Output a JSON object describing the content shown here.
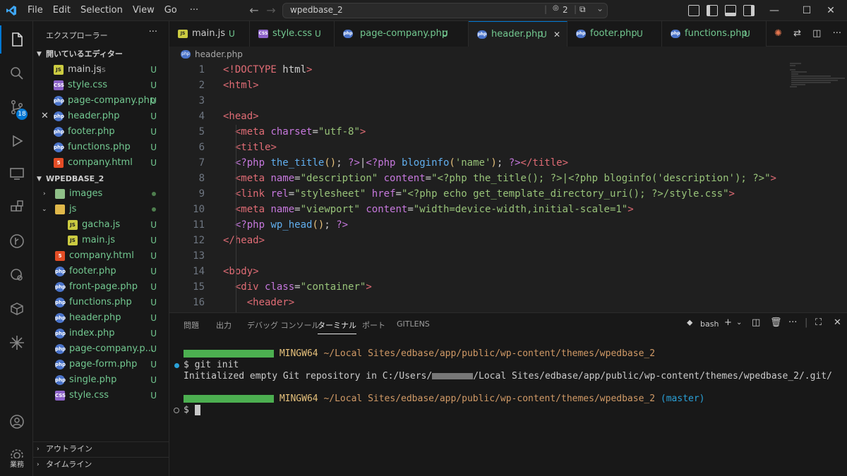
{
  "titlebar": {
    "menu": [
      "File",
      "Edit",
      "Selection",
      "View",
      "Go",
      "···"
    ],
    "search": "wpedbase_2",
    "source_control_count": "2"
  },
  "activity": {
    "scm_badge": "18",
    "account_label": "業務"
  },
  "sidebar": {
    "title": "エクスプローラー",
    "open_editors_title": "開いているエディター",
    "open_editors": [
      {
        "name": "main.js",
        "extra": "js",
        "icon": "js",
        "status": "U"
      },
      {
        "name": "style.css",
        "icon": "css",
        "status": "U"
      },
      {
        "name": "page-company.php",
        "icon": "php",
        "status": "U"
      },
      {
        "name": "header.php",
        "icon": "php",
        "status": "U"
      },
      {
        "name": "footer.php",
        "icon": "php",
        "status": "U"
      },
      {
        "name": "functions.php",
        "icon": "php",
        "status": "U"
      },
      {
        "name": "company.html",
        "icon": "html",
        "status": "U"
      }
    ],
    "project_title": "WPEDBASE_2",
    "tree": [
      {
        "name": "images",
        "icon": "folder",
        "status": "dot"
      },
      {
        "name": "js",
        "icon": "jsfolder",
        "status": "dot"
      },
      {
        "name": "gacha.js",
        "icon": "js",
        "status": "U"
      },
      {
        "name": "main.js",
        "icon": "js",
        "status": "U"
      },
      {
        "name": "company.html",
        "icon": "html",
        "status": "U"
      },
      {
        "name": "footer.php",
        "icon": "php",
        "status": "U"
      },
      {
        "name": "front-page.php",
        "icon": "php",
        "status": "U"
      },
      {
        "name": "functions.php",
        "icon": "php",
        "status": "U"
      },
      {
        "name": "header.php",
        "icon": "php",
        "status": "U"
      },
      {
        "name": "index.php",
        "icon": "php",
        "status": "U"
      },
      {
        "name": "page-company.p...",
        "icon": "php",
        "status": "U"
      },
      {
        "name": "page-form.php",
        "icon": "php",
        "status": "U"
      },
      {
        "name": "single.php",
        "icon": "php",
        "status": "U"
      },
      {
        "name": "style.css",
        "icon": "css",
        "status": "U"
      }
    ],
    "outline": "アウトライン",
    "timeline": "タイムライン"
  },
  "tabs": [
    {
      "name": "main.js",
      "icon": "js",
      "status": "U"
    },
    {
      "name": "style.css",
      "icon": "css",
      "status": "U"
    },
    {
      "name": "page-company.php",
      "icon": "php",
      "status": "U"
    },
    {
      "name": "header.php",
      "icon": "php",
      "status": "U"
    },
    {
      "name": "footer.php",
      "icon": "php",
      "status": "U"
    },
    {
      "name": "functions.php",
      "icon": "php",
      "status": "U"
    }
  ],
  "breadcrumb": "header.php",
  "editor": {
    "line_numbers": [
      "1",
      "2",
      "3",
      "4",
      "5",
      "6",
      "7",
      "8",
      "9",
      "10",
      "11",
      "12",
      "13",
      "14",
      "15",
      "16"
    ],
    "lines": [
      "<!DOCTYPE html>",
      "<html>",
      "",
      "<head>",
      "  <meta charset=\"utf-8\">",
      "  <title>",
      "  <?php the_title(); ?>|<?php bloginfo('name'); ?></title>",
      "  <meta name=\"description\" content=\"<?php the_title(); ?>|<?php bloginfo('description'); ?>\">",
      "  <link rel=\"stylesheet\" href=\"<?php echo get_template_directory_uri(); ?>/style.css\">",
      "  <meta name=\"viewport\" content=\"width=device-width,initial-scale=1\">",
      "  <?php wp_head(); ?>",
      "</head>",
      "",
      "<body>",
      "  <div class=\"container\">",
      "    <header>"
    ]
  },
  "panel": {
    "tabs": [
      "問題",
      "出力",
      "デバッグ コンソール",
      "ターミナル",
      "ポート",
      "GITLENS"
    ],
    "active_tab": "ターミナル",
    "shell": "bash",
    "terminal": {
      "prompt1_host": "MINGW64",
      "prompt1_path": "~/Local Sites/edbase/app/public/wp-content/themes/wpedbase_2",
      "cmd": "$ git init",
      "output_pre": "Initialized empty Git repository in C:/Users/",
      "output_post": "/Local Sites/edbase/app/public/wp-content/themes/wpedbase_2/.git/",
      "prompt2_host": "MINGW64",
      "prompt2_path": "~/Local Sites/edbase/app/public/wp-content/themes/wpedbase_2",
      "prompt2_branch": "(master)",
      "cmd2": "$ "
    }
  },
  "colors": {
    "accent": "#0078d4",
    "untracked": "#73c991",
    "bg": "#1f1f1f"
  }
}
